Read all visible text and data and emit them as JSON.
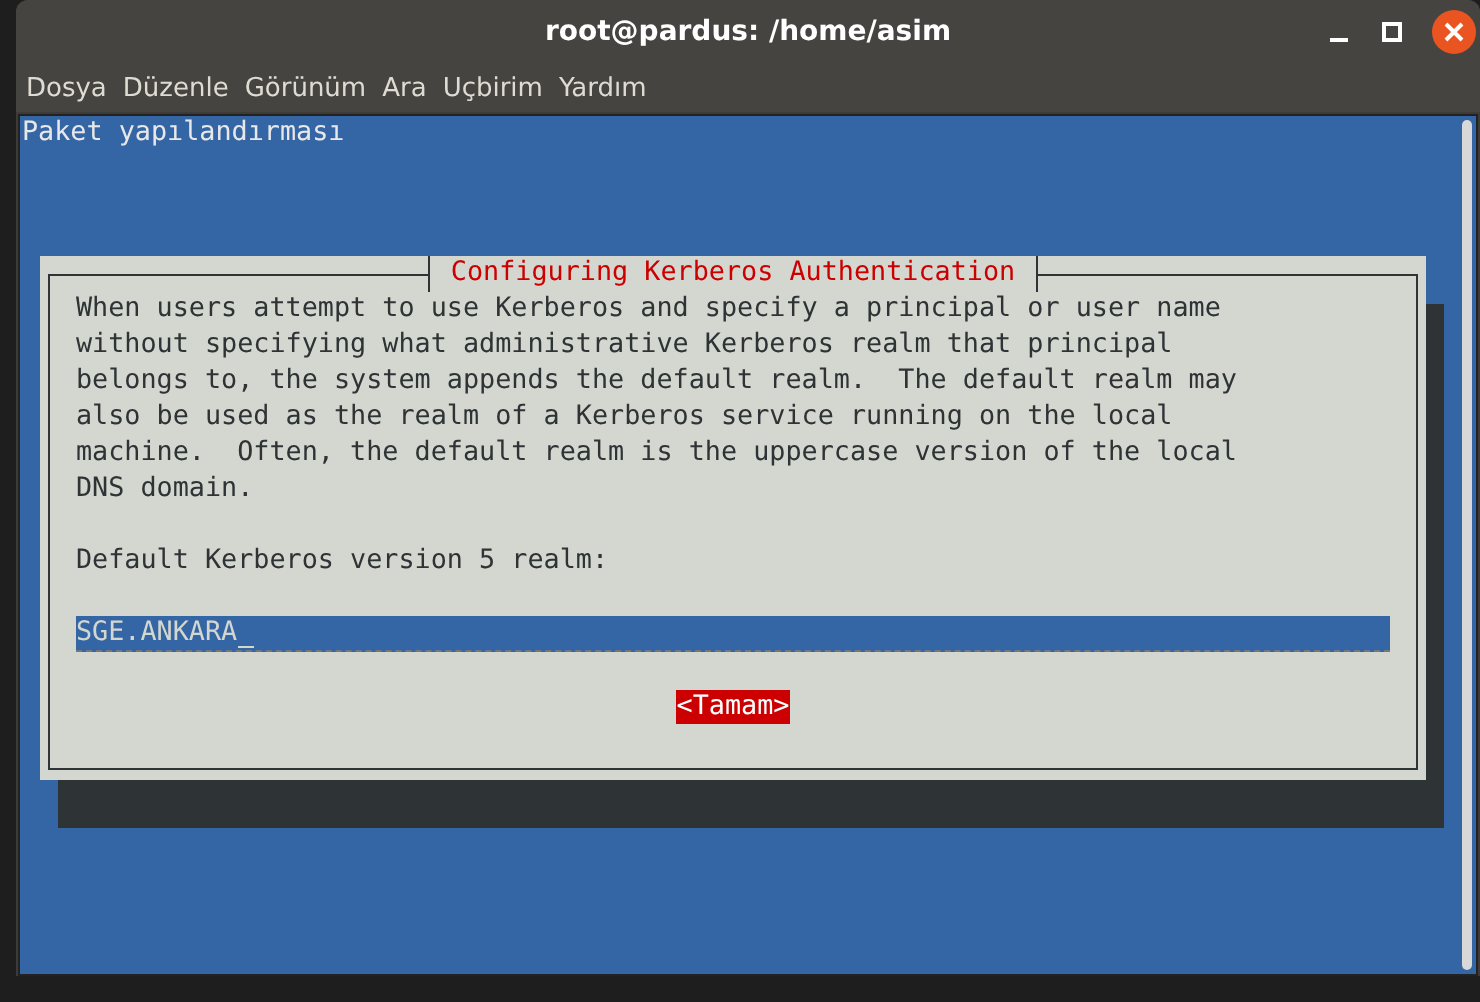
{
  "window": {
    "title": "root@pardus: /home/asim"
  },
  "menu": [
    "Dosya",
    "Düzenle",
    "Görünüm",
    "Ara",
    "Uçbirim",
    "Yardım"
  ],
  "terminal": {
    "header": "Paket yapılandırması",
    "dialog": {
      "title": "Configuring Kerberos Authentication",
      "body": [
        "When users attempt to use Kerberos and specify a principal or user name",
        "without specifying what administrative Kerberos realm that principal",
        "belongs to, the system appends the default realm.  The default realm may",
        "also be used as the realm of a Kerberos service running on the local",
        "machine.  Often, the default realm is the uppercase version of the local",
        "DNS domain."
      ],
      "prompt": "Default Kerberos version 5 realm:",
      "field": {
        "value": "SGE.ANKARA"
      },
      "button": {
        "label": "<Tamam>",
        "selected": true
      }
    }
  }
}
